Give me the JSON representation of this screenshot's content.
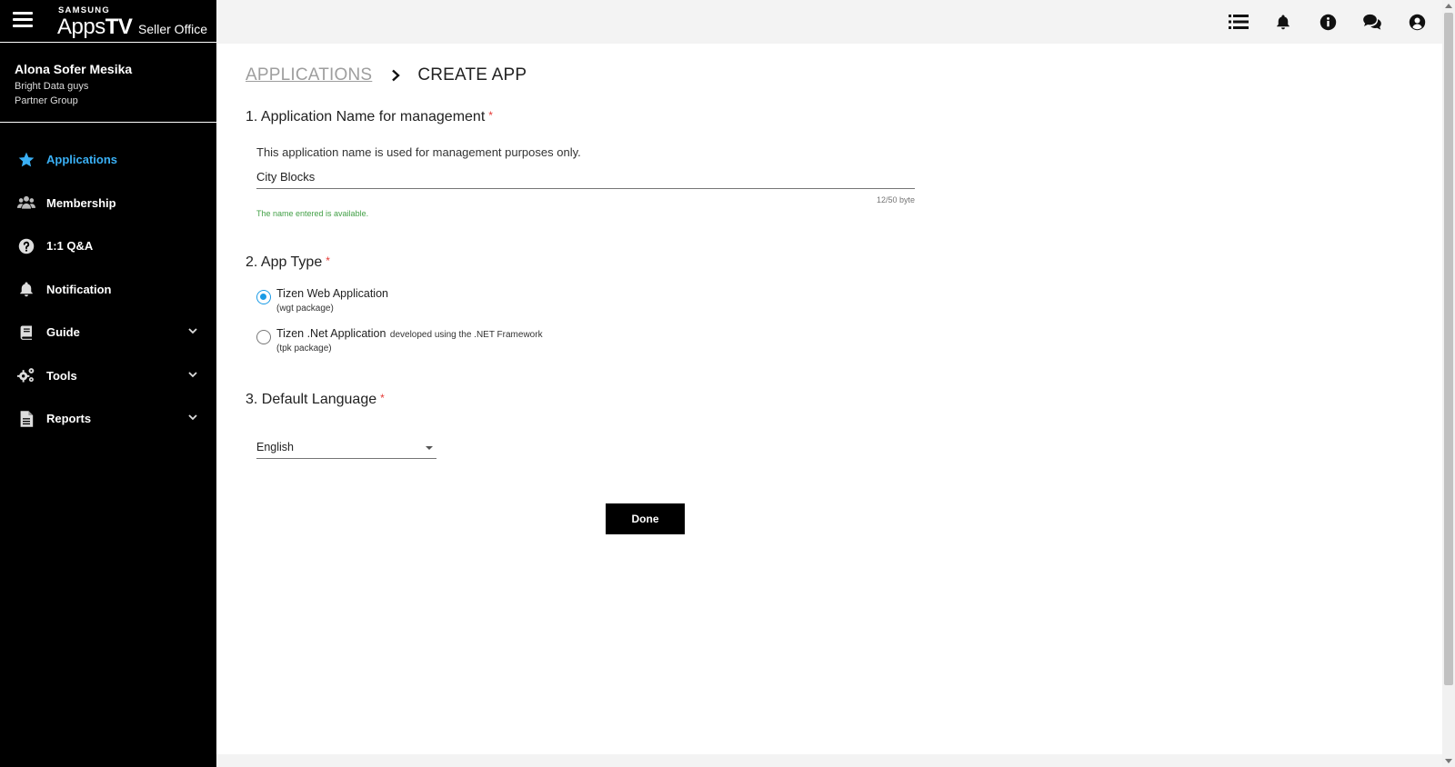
{
  "brand": {
    "samsung": "SAMSUNG",
    "apps": "Apps",
    "tv": "TV",
    "seller_office": "Seller Office"
  },
  "user": {
    "name": "Alona Sofer Mesika",
    "group": "Bright Data guys",
    "partner": "Partner Group"
  },
  "nav": {
    "items": [
      {
        "label": "Applications",
        "icon": "star-icon",
        "active": true
      },
      {
        "label": "Membership",
        "icon": "users-icon"
      },
      {
        "label": "1:1 Q&A",
        "icon": "question-icon"
      },
      {
        "label": "Notification",
        "icon": "bell-icon"
      },
      {
        "label": "Guide",
        "icon": "book-icon",
        "expandable": true
      },
      {
        "label": "Tools",
        "icon": "gears-icon",
        "expandable": true
      },
      {
        "label": "Reports",
        "icon": "document-icon",
        "expandable": true
      }
    ]
  },
  "topbar": {
    "icons": [
      "list-icon",
      "bell-icon",
      "info-icon",
      "chat-icon",
      "account-icon"
    ]
  },
  "breadcrumb": {
    "parent": "APPLICATIONS",
    "current": "CREATE APP"
  },
  "section1": {
    "title": "1. Application Name for management",
    "required_mark": "*",
    "description": "This application name is used for management purposes only.",
    "input_value": "City Blocks",
    "counter": "12/50 byte",
    "availability": "The name entered is available."
  },
  "section2": {
    "title": "2. App Type",
    "required_mark": "*",
    "options": [
      {
        "label": "Tizen Web Application",
        "extra": "",
        "sub": "(wgt package)",
        "checked": true
      },
      {
        "label": "Tizen .Net Application",
        "extra": "developed using the .NET Framework",
        "sub": "(tpk package)",
        "checked": false
      }
    ]
  },
  "section3": {
    "title": "3. Default Language",
    "required_mark": "*",
    "selected": "English"
  },
  "done_label": "Done",
  "colors": {
    "accent": "#1a9be6",
    "active_nav": "#3ab0f5",
    "success": "#43a047",
    "required": "#e53935"
  }
}
